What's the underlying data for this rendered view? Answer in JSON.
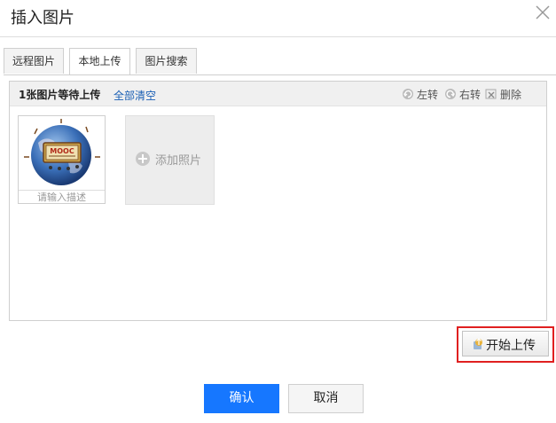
{
  "dialog": {
    "title": "插入图片",
    "close_icon": "close-icon"
  },
  "tabs": [
    {
      "label": "远程图片"
    },
    {
      "label": "本地上传",
      "active": true
    },
    {
      "label": "图片搜索"
    }
  ],
  "queue": {
    "count_text": "1张图片等待上传",
    "clear_all": "全部清空",
    "actions": [
      {
        "label": "左转",
        "icon": "rotate-left-icon"
      },
      {
        "label": "右转",
        "icon": "rotate-right-icon"
      },
      {
        "label": "删除",
        "icon": "delete-icon"
      }
    ]
  },
  "thumbnail": {
    "logo_text": "MOOC",
    "desc_placeholder": "请输入描述"
  },
  "add_photo": {
    "label": "添加照片"
  },
  "upload_button": {
    "label": "开始上传"
  },
  "footer": {
    "ok_label": "确认",
    "cancel_label": "取消"
  },
  "colors": {
    "primary": "#1677ff",
    "highlight": "#e02020",
    "link": "#1a5fb4"
  }
}
